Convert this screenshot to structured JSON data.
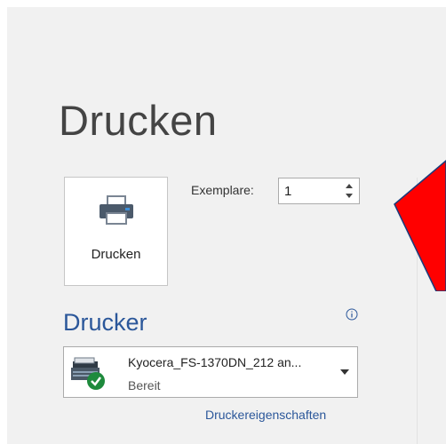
{
  "print": {
    "title": "Drucken",
    "button_label": "Drucken",
    "copies_label": "Exemplare:",
    "copies_value": "1"
  },
  "printer": {
    "section_title": "Drucker",
    "name": "Kyocera_FS-1370DN_212 an...",
    "status": "Bereit",
    "properties_link": "Druckereigenschaften"
  },
  "colors": {
    "panel_background": "#f1f1f1",
    "accent_blue": "#2b579a",
    "annotation_red": "#ff0000",
    "status_green": "#1e8a3c"
  },
  "icons": {
    "print_button": "printer-icon",
    "info": "info-icon",
    "printer_device": "printer-device-icon",
    "status_ok": "checkmark-icon",
    "dropdown": "chevron-down-icon"
  }
}
